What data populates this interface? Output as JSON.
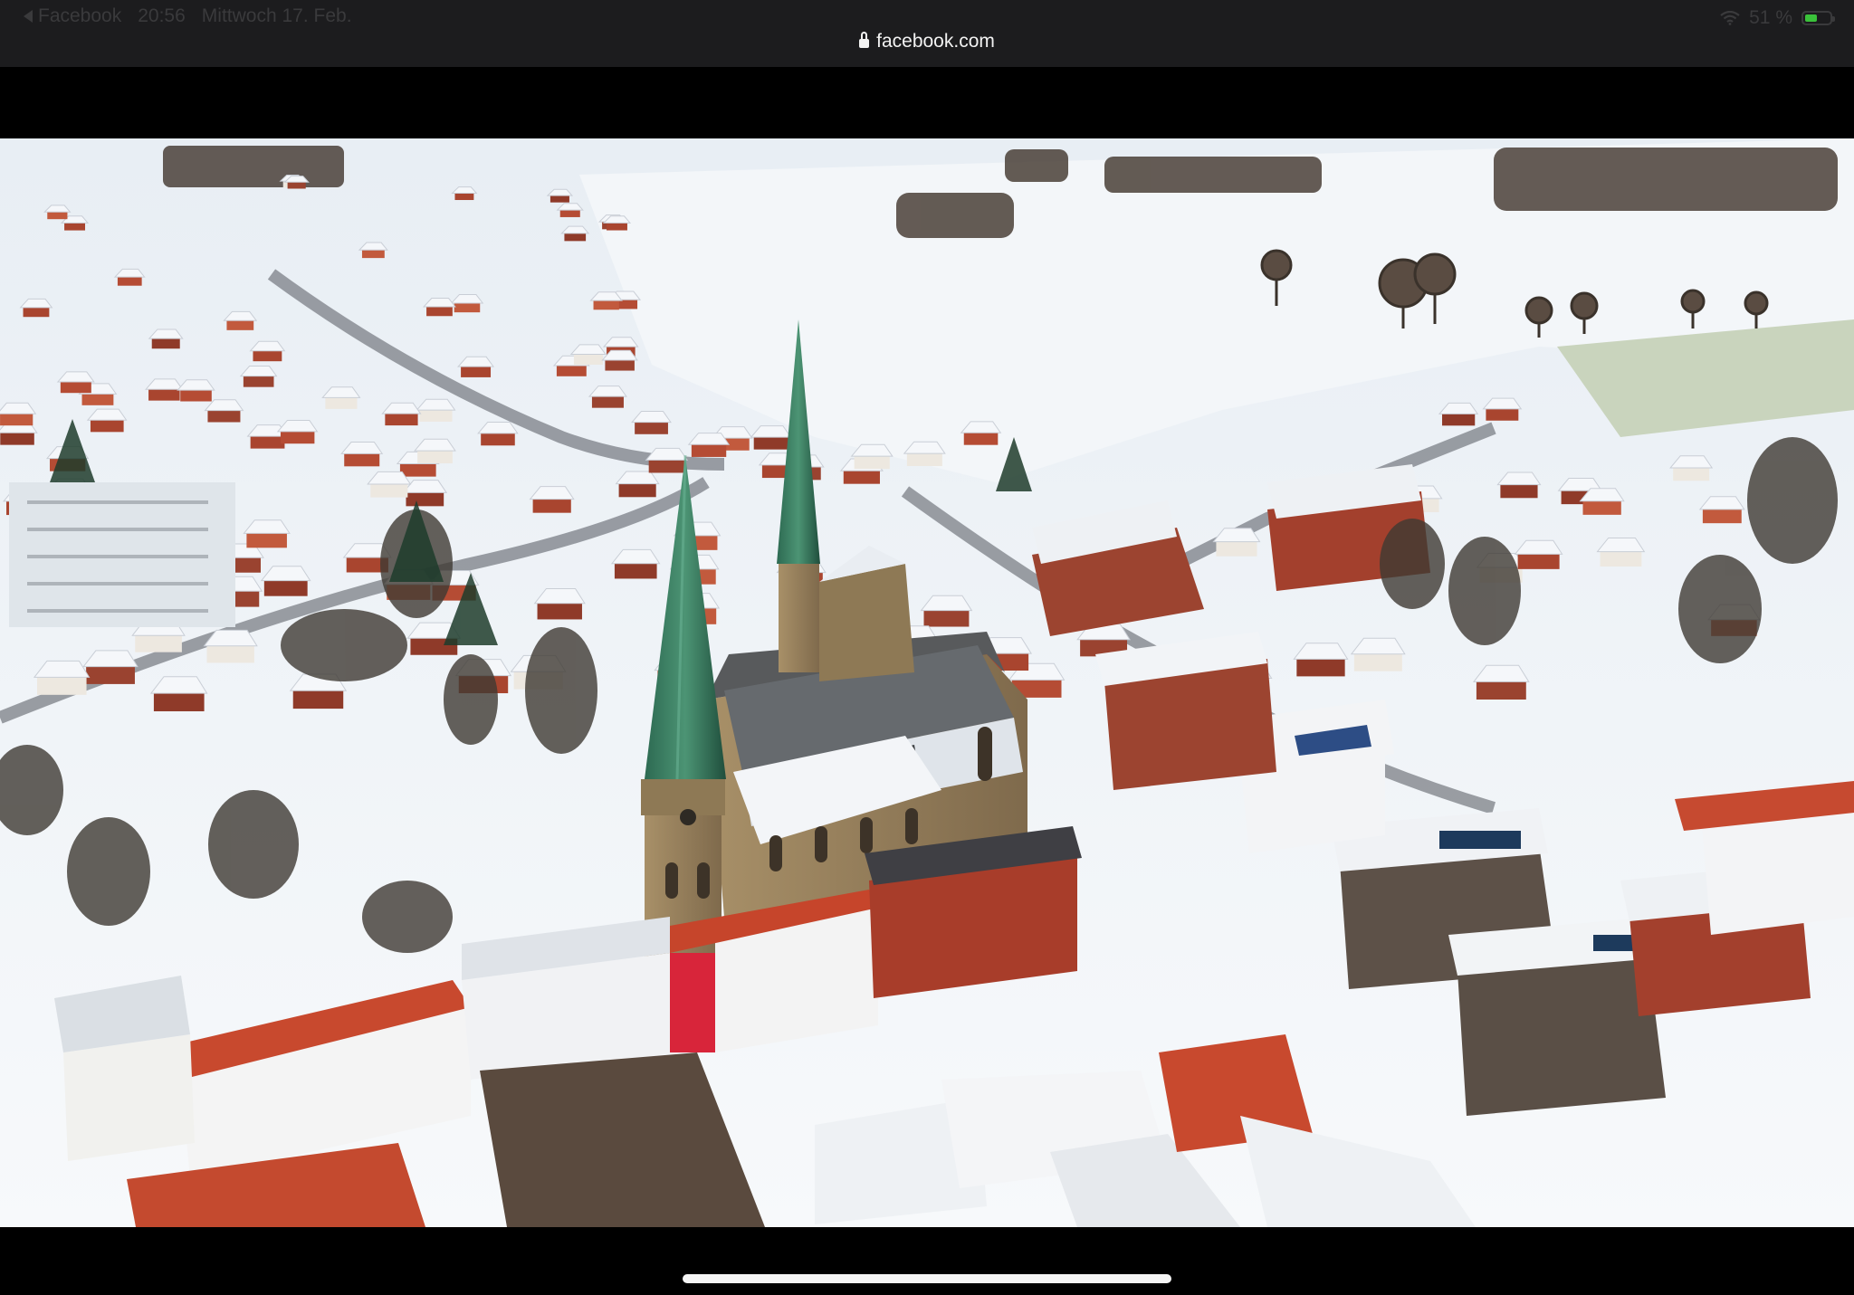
{
  "status_bar": {
    "back_app": "Facebook",
    "time": "20:56",
    "date": "Mittwoch 17. Feb.",
    "battery_percent": "51 %",
    "battery_level": 0.51
  },
  "browser": {
    "url": "facebook.com"
  },
  "photo": {
    "subject": "aerial-winter-town-with-church",
    "icons": [
      "wifi-icon",
      "battery-icon",
      "lock-icon",
      "back-arrow-icon"
    ]
  }
}
